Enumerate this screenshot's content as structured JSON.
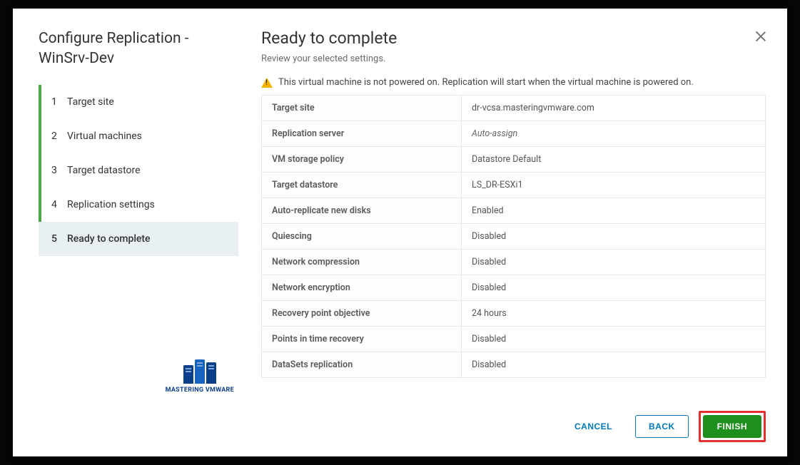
{
  "wizard": {
    "title": "Configure Replication - WinSrv-Dev",
    "steps": [
      {
        "num": "1",
        "label": "Target site"
      },
      {
        "num": "2",
        "label": "Virtual machines"
      },
      {
        "num": "3",
        "label": "Target datastore"
      },
      {
        "num": "4",
        "label": "Replication settings"
      },
      {
        "num": "5",
        "label": "Ready to complete"
      }
    ],
    "activeStepIndex": 4
  },
  "page": {
    "title": "Ready to complete",
    "description": "Review your selected settings.",
    "warning": "This virtual machine is not powered on. Replication will start when the virtual machine is powered on."
  },
  "summary": [
    {
      "key": "Target site",
      "value": "dr-vcsa.masteringvmware.com"
    },
    {
      "key": "Replication server",
      "value": "Auto-assign",
      "italic": true
    },
    {
      "key": "VM storage policy",
      "value": "Datastore Default"
    },
    {
      "key": "Target datastore",
      "value": "LS_DR-ESXi1"
    },
    {
      "key": "Auto-replicate new disks",
      "value": "Enabled"
    },
    {
      "key": "Quiescing",
      "value": "Disabled"
    },
    {
      "key": "Network compression",
      "value": "Disabled"
    },
    {
      "key": "Network encryption",
      "value": "Disabled"
    },
    {
      "key": "Recovery point objective",
      "value": "24 hours"
    },
    {
      "key": "Points in time recovery",
      "value": "Disabled"
    },
    {
      "key": "DataSets replication",
      "value": "Disabled"
    }
  ],
  "footer": {
    "cancel": "Cancel",
    "back": "Back",
    "finish": "Finish"
  },
  "branding": {
    "text": "MASTERING VMWARE"
  }
}
